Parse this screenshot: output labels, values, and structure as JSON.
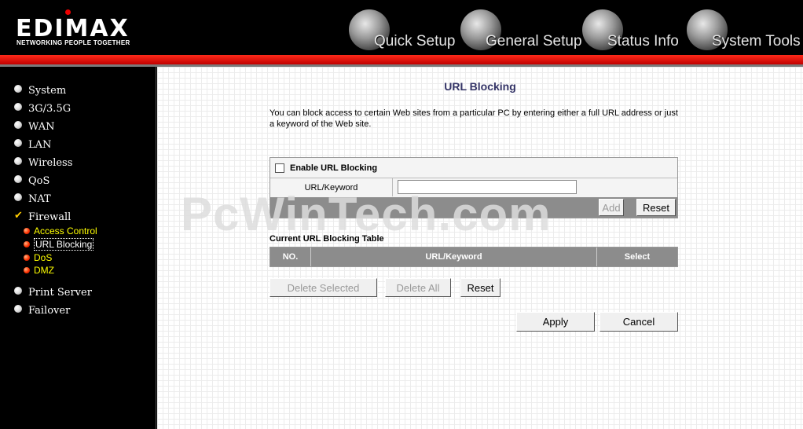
{
  "brand": {
    "logo": "EDIMAX",
    "tagline": "NETWORKING PEOPLE TOGETHER"
  },
  "nav": [
    {
      "label": "Quick Setup",
      "icon": "quick-setup-icon"
    },
    {
      "label": "General Setup",
      "icon": "general-setup-icon"
    },
    {
      "label": "Status Info",
      "icon": "status-info-icon"
    },
    {
      "label": "System Tools",
      "icon": "system-tools-icon"
    }
  ],
  "sidebar": {
    "items": [
      {
        "label": "System"
      },
      {
        "label": "3G/3.5G"
      },
      {
        "label": "WAN"
      },
      {
        "label": "LAN"
      },
      {
        "label": "Wireless"
      },
      {
        "label": "QoS"
      },
      {
        "label": "NAT"
      },
      {
        "label": "Firewall",
        "checked": true
      },
      {
        "label": "Print Server"
      },
      {
        "label": "Failover"
      }
    ],
    "firewall_sub": [
      {
        "label": "Access Control"
      },
      {
        "label": "URL Blocking",
        "active": true
      },
      {
        "label": "DoS"
      },
      {
        "label": "DMZ"
      }
    ]
  },
  "page": {
    "title": "URL Blocking",
    "description": "You can block access to certain Web sites from a particular PC by entering either a full URL address or just a keyword of the Web site.",
    "enable_label": "Enable URL Blocking",
    "enable_checked": false,
    "keyword_label": "URL/Keyword",
    "keyword_value": "",
    "add_label": "Add",
    "reset_label": "Reset",
    "table_title": "Current URL Blocking Table",
    "table_headers": [
      "NO.",
      "URL/Keyword",
      "Select"
    ],
    "delete_selected_label": "Delete Selected",
    "delete_all_label": "Delete All",
    "table_reset_label": "Reset",
    "apply_label": "Apply",
    "cancel_label": "Cancel"
  },
  "watermark": "PcWinTech.com",
  "colors": {
    "accent_red": "#e00000",
    "sidebar_bg": "#000000",
    "submenu_text": "#ffff00",
    "title_blue": "#333366"
  }
}
